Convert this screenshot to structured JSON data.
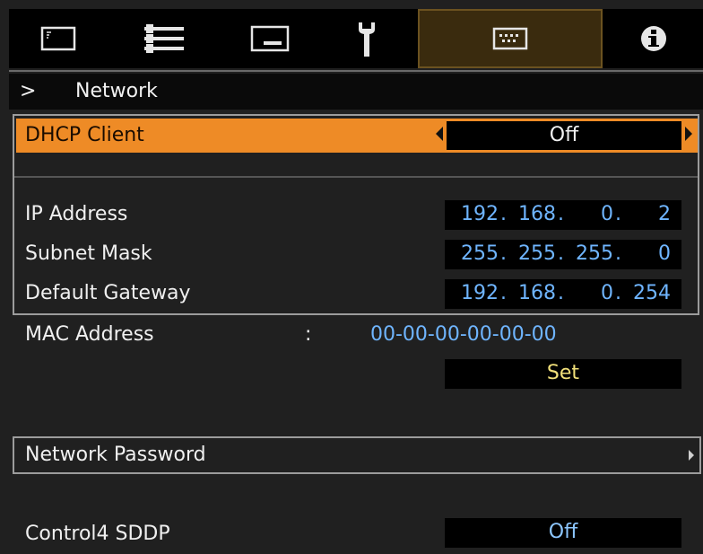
{
  "tabs": [
    {
      "icon": "picture-icon",
      "active": false
    },
    {
      "icon": "sliders-icon",
      "active": false
    },
    {
      "icon": "display-icon",
      "active": false
    },
    {
      "icon": "wrench-icon",
      "active": false
    },
    {
      "icon": "network-keyboard-icon",
      "active": true
    },
    {
      "icon": "info-icon",
      "active": false
    }
  ],
  "breadcrumb": {
    "marker": ">",
    "title": "Network"
  },
  "dhcp": {
    "label": "DHCP Client",
    "value": "Off"
  },
  "ip_address": {
    "label": "IP Address",
    "octets": [
      "192",
      "168",
      "0",
      "2"
    ]
  },
  "subnet_mask": {
    "label": "Subnet Mask",
    "octets": [
      "255",
      "255",
      "255",
      "0"
    ]
  },
  "default_gateway": {
    "label": "Default Gateway",
    "octets": [
      "192",
      "168",
      "0",
      "254"
    ]
  },
  "mac": {
    "label": "MAC Address",
    "colon": ":",
    "value": "00-00-00-00-00-00"
  },
  "set_button": {
    "label": "Set"
  },
  "network_password": {
    "label": "Network Password"
  },
  "control4": {
    "label": "Control4 SDDP",
    "value": "Off"
  },
  "colors": {
    "highlight": "#ee8b26",
    "value_blue": "#6fb5ff",
    "set_yellow": "#f1e07a"
  }
}
